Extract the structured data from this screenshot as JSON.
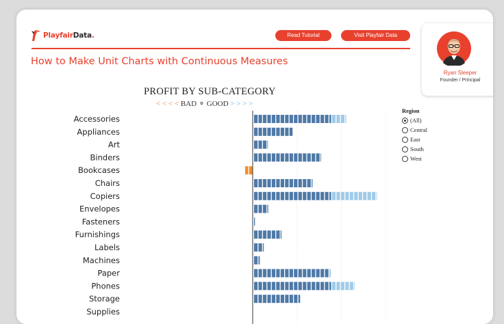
{
  "header": {
    "logo_brand": "Playfair",
    "logo_suffix": "Data",
    "logo_dot": ".",
    "tutorial_button": "Read Tutorial",
    "visit_button": "Visit Playfair Data",
    "page_title": "How to Make Unit Charts with Continuous Measures"
  },
  "profile": {
    "name": "Ryan Sleeper",
    "role": "Founder / Principal"
  },
  "chart": {
    "title": "PROFIT BY SUB-CATEGORY",
    "bad_arrows": "< < < <",
    "bad_label": "BAD",
    "separator": "⚬",
    "good_label": "GOOD",
    "good_arrows": "> > > >"
  },
  "filter": {
    "title": "Region",
    "options": [
      "(All)",
      "Central",
      "East",
      "South",
      "West"
    ],
    "selected": "(All)"
  },
  "colors": {
    "accent": "#e8412e",
    "bar_dark": "#4e79a7",
    "bar_light": "#a0cbe8",
    "bar_negative": "#f28e2b"
  },
  "chart_data": {
    "type": "bar",
    "orientation": "horizontal",
    "encoding": "unit",
    "categories": [
      "Accessories",
      "Appliances",
      "Art",
      "Binders",
      "Bookcases",
      "Chairs",
      "Copiers",
      "Envelopes",
      "Fasteners",
      "Furnishings",
      "Labels",
      "Machines",
      "Paper",
      "Phones",
      "Storage",
      "Supplies"
    ],
    "series": [
      {
        "values": [
          17.6,
          8.9,
          3.1,
          15.2,
          -1.9,
          13.4,
          17.6,
          3.4,
          0.4,
          6.4,
          2.4,
          1.5,
          17.0,
          17.6,
          10.6,
          0.0
        ]
      },
      {
        "values": [
          3.4,
          0,
          0,
          0,
          0,
          0,
          10.3,
          0,
          0,
          0,
          0,
          0,
          0.5,
          5.2,
          0,
          0
        ]
      }
    ],
    "xlim": [
      -5,
      30
    ],
    "grid": true
  }
}
